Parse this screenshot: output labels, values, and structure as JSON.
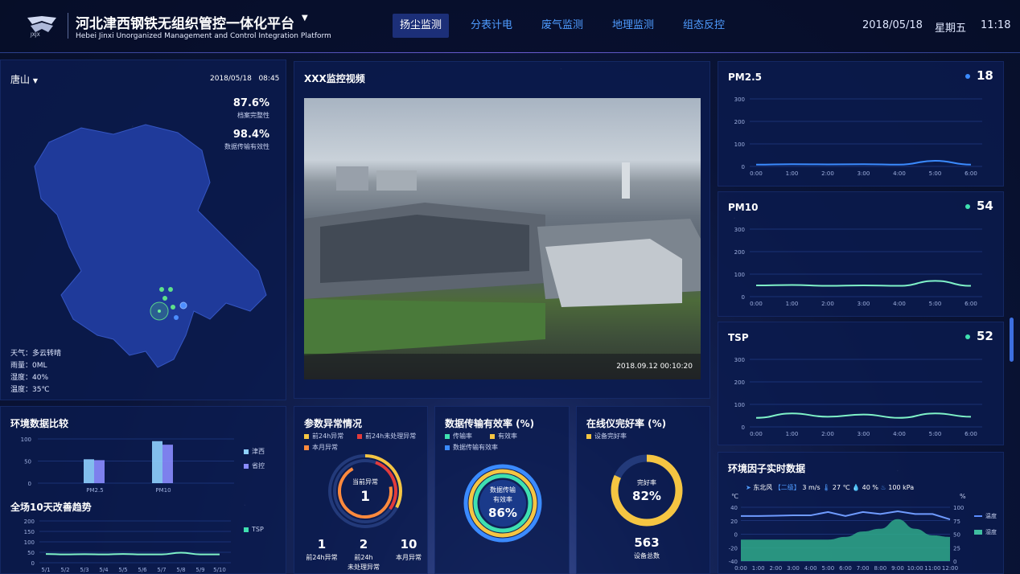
{
  "header": {
    "title": "河北津西钢铁无组织管控一体化平台",
    "subtitle": "Hebei Jinxi Unorganized Management and Control Integration Platform",
    "logo_text": "JXJX",
    "nav": [
      "扬尘监测",
      "分表计电",
      "废气监测",
      "地理监测",
      "组态反控"
    ],
    "active_nav": 0,
    "date": "2018/05/18",
    "weekday": "星期五",
    "time": "11:18"
  },
  "map": {
    "region": "唐山",
    "datetime": "2018/05/18   08:45",
    "stat1_value": "87.6%",
    "stat1_label": "档案完整性",
    "stat2_value": "98.4%",
    "stat2_label": "数据传输有效性",
    "weather": [
      "天气：多云转晴",
      "雨量：0ML",
      "湿度：40%",
      "温度：35℃"
    ]
  },
  "video": {
    "title": "XXX监控视频",
    "timestamp": "2018.09.12 00:10:20"
  },
  "pm25": {
    "title": "PM2.5",
    "value": "18",
    "dot_color": "#3b8bff"
  },
  "pm10": {
    "title": "PM10",
    "value": "54",
    "dot_color": "#3fe0b0"
  },
  "tsp": {
    "title": "TSP",
    "value": "52",
    "dot_color": "#3fe0b0"
  },
  "env_compare": {
    "title": "环境数据比较",
    "legend": [
      "津西",
      "省控"
    ]
  },
  "trend": {
    "title": "全场10天改善趋势",
    "legend": "TSP"
  },
  "anomaly": {
    "title": "参数异常情况",
    "legend": [
      "前24h异常",
      "前24h未处理异常",
      "本月异常"
    ],
    "center_label": "当前异常",
    "center_value": "1",
    "stats": [
      {
        "value": "1",
        "label": "前24h异常"
      },
      {
        "value": "2",
        "label": "前24h\n未处理异常"
      },
      {
        "value": "10",
        "label": "本月异常"
      }
    ]
  },
  "transmission": {
    "title": "数据传输有效率 (%)",
    "legend": [
      "传输率",
      "有效率",
      "数据传输有效率"
    ],
    "center_label1": "数据传输",
    "center_label2": "有效率",
    "center_value": "86%"
  },
  "online": {
    "title": "在线仪完好率 (%)",
    "legend": "设备完好率",
    "center_label": "完好率",
    "center_value": "82%",
    "total_value": "563",
    "total_label": "设备总数"
  },
  "env_factor": {
    "title": "环境因子实时数据",
    "wind_dir": "东北风",
    "wind_level": "【二级】",
    "wind_speed": "3",
    "wind_unit": "m/s",
    "temp": "27",
    "temp_unit": "℃",
    "humidity": "40",
    "humidity_unit": "%",
    "pressure": "100",
    "pressure_unit": "kPa",
    "left_unit": "℃",
    "right_unit": "%",
    "legend": [
      "温度",
      "湿度"
    ]
  },
  "chart_data": [
    {
      "type": "line",
      "title": "PM2.5",
      "x": [
        "0:00",
        "1:00",
        "2:00",
        "3:00",
        "4:00",
        "5:00",
        "6:00"
      ],
      "ylim": [
        0,
        300
      ],
      "yticks": [
        0,
        100,
        200,
        300
      ],
      "series": [
        {
          "values": [
            8,
            10,
            9,
            10,
            8,
            25,
            8
          ]
        }
      ]
    },
    {
      "type": "line",
      "title": "PM10",
      "x": [
        "0:00",
        "1:00",
        "2:00",
        "3:00",
        "4:00",
        "5:00",
        "6:00"
      ],
      "ylim": [
        0,
        300
      ],
      "yticks": [
        0,
        100,
        200,
        300
      ],
      "series": [
        {
          "values": [
            50,
            52,
            48,
            50,
            48,
            70,
            48
          ]
        }
      ]
    },
    {
      "type": "line",
      "title": "TSP",
      "x": [
        "0:00",
        "1:00",
        "2:00",
        "3:00",
        "4:00",
        "5:00",
        "6:00"
      ],
      "ylim": [
        0,
        300
      ],
      "yticks": [
        0,
        100,
        200,
        300
      ],
      "series": [
        {
          "values": [
            40,
            60,
            45,
            55,
            40,
            60,
            45
          ]
        }
      ]
    },
    {
      "type": "bar",
      "title": "环境数据比较",
      "categories": [
        "PM2.5",
        "PM10"
      ],
      "ylim": [
        0,
        100
      ],
      "yticks": [
        0,
        50,
        100
      ],
      "series": [
        {
          "name": "津西",
          "values": [
            54,
            95
          ]
        },
        {
          "name": "省控",
          "values": [
            52,
            87
          ]
        }
      ]
    },
    {
      "type": "line",
      "title": "全场10天改善趋势",
      "x": [
        "5/1",
        "5/2",
        "5/3",
        "5/4",
        "5/5",
        "5/6",
        "5/7",
        "5/8",
        "5/9",
        "5/10"
      ],
      "ylim": [
        0,
        200
      ],
      "yticks": [
        0,
        50,
        100,
        150,
        200
      ],
      "series": [
        {
          "name": "TSP",
          "values": [
            42,
            40,
            41,
            40,
            42,
            40,
            40,
            48,
            40,
            40
          ]
        }
      ]
    },
    {
      "type": "line",
      "title": "环境因子实时数据",
      "x": [
        "0:00",
        "1:00",
        "2:00",
        "3:00",
        "4:00",
        "5:00",
        "6:00",
        "7:00",
        "8:00",
        "9:00",
        "10:00",
        "11:00",
        "12:00"
      ],
      "ylim": [
        -40,
        40
      ],
      "yticks": [
        -40,
        -20,
        0,
        20,
        40
      ],
      "y2lim": [
        0,
        100
      ],
      "y2ticks": [
        0,
        25,
        50,
        75,
        100
      ],
      "series": [
        {
          "name": "温度",
          "axis": "left",
          "values": [
            27,
            27,
            27.5,
            28,
            28,
            33,
            27,
            33,
            30,
            34,
            30,
            30,
            22
          ]
        },
        {
          "name": "湿度",
          "axis": "right",
          "values": [
            40,
            40,
            40,
            40,
            40,
            40,
            45,
            55,
            60,
            78,
            60,
            48,
            45
          ]
        }
      ]
    }
  ]
}
